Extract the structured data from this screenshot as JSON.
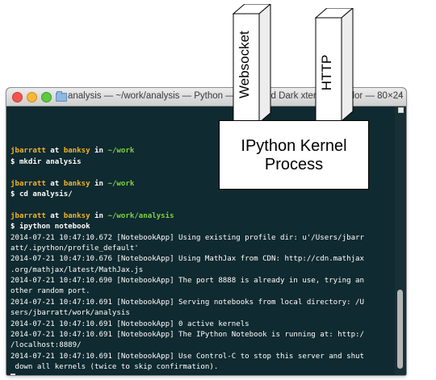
{
  "terminal": {
    "title": "analysis — ~/work/analysis — Python — Solarized Dark xterm-256color — 80×24",
    "lines": [
      {
        "type": "blank"
      },
      {
        "type": "prompt",
        "user": "jbarratt",
        "at": " at ",
        "host": "banksy",
        "in": " in ",
        "path": "~/work"
      },
      {
        "type": "cmd",
        "text": "$ mkdir analysis"
      },
      {
        "type": "blank"
      },
      {
        "type": "prompt",
        "user": "jbarratt",
        "at": " at ",
        "host": "banksy",
        "in": " in ",
        "path": "~/work"
      },
      {
        "type": "cmd",
        "text": "$ cd analysis/"
      },
      {
        "type": "blank"
      },
      {
        "type": "prompt",
        "user": "jbarratt",
        "at": " at ",
        "host": "banksy",
        "in": " in ",
        "path": "~/work/analysis"
      },
      {
        "type": "cmd",
        "text": "$ ipython notebook"
      },
      {
        "type": "log",
        "text": "2014-07-21 10:47:10.672 [NotebookApp] Using existing profile dir: u'/Users/jbarr"
      },
      {
        "type": "log",
        "text": "att/.ipython/profile_default'"
      },
      {
        "type": "log",
        "text": "2014-07-21 10:47:10.676 [NotebookApp] Using MathJax from CDN: http://cdn.mathjax"
      },
      {
        "type": "log",
        "text": ".org/mathjax/latest/MathJax.js"
      },
      {
        "type": "log",
        "text": "2014-07-21 10:47:10.690 [NotebookApp] The port 8888 is already in use, trying an"
      },
      {
        "type": "log",
        "text": "other random port."
      },
      {
        "type": "log",
        "text": "2014-07-21 10:47:10.691 [NotebookApp] Serving notebooks from local directory: /U"
      },
      {
        "type": "log",
        "text": "sers/jbarratt/work/analysis"
      },
      {
        "type": "log",
        "text": "2014-07-21 10:47:10.691 [NotebookApp] 0 active kernels"
      },
      {
        "type": "log",
        "text": "2014-07-21 10:47:10.691 [NotebookApp] The IPython Notebook is running at: http:/"
      },
      {
        "type": "log",
        "text": "/localhost:8889/"
      },
      {
        "type": "log",
        "text": "2014-07-21 10:47:10.691 [NotebookApp] Use Control-C to stop this server and shut"
      },
      {
        "type": "log",
        "text": " down all kernels (twice to skip confirmation)."
      },
      {
        "type": "cursor"
      }
    ],
    "colors": {
      "background": "#0f2a30",
      "prompt": "#f0b429",
      "path": "#7fd23f",
      "text": "#ffffff"
    }
  },
  "diagram": {
    "pillars": [
      {
        "label": "Websocket"
      },
      {
        "label": "HTTP"
      }
    ],
    "kernel_lines": [
      "IPython Kernel",
      "Process"
    ]
  }
}
